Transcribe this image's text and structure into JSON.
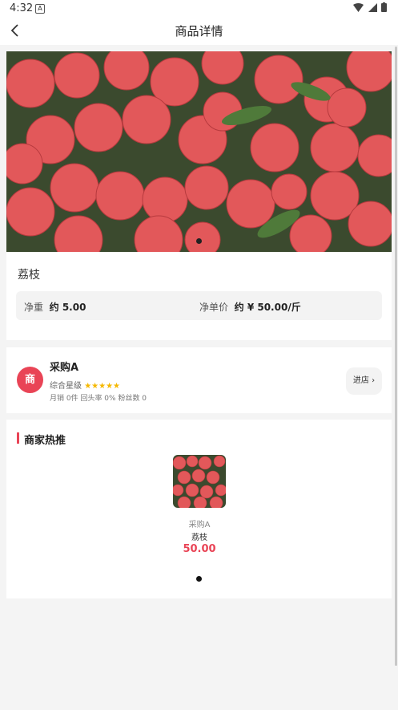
{
  "status_bar": {
    "time": "4:32",
    "notification_icon": "A",
    "right_icons": "▼◢▮"
  },
  "nav": {
    "title": "商品详情",
    "back_icon": "‹"
  },
  "product": {
    "name": "荔枝",
    "weight_label": "净重",
    "weight_value": "约 5.00",
    "unit_price_label": "净单价",
    "unit_price_value": "约 ¥ 50.00/斤"
  },
  "shop": {
    "logo_text": "商",
    "name": "采购A",
    "rating_label": "综合星级",
    "stars": "★★★★★",
    "stats": "月销 0件  回头率 0%  粉丝数 0",
    "enter_label": "进店 ›"
  },
  "hot": {
    "title": "商家热推",
    "items": [
      {
        "shop": "采购A",
        "name": "荔枝",
        "price": "50.00"
      }
    ]
  },
  "colors": {
    "accent": "#e94456",
    "star": "#f5b800"
  }
}
